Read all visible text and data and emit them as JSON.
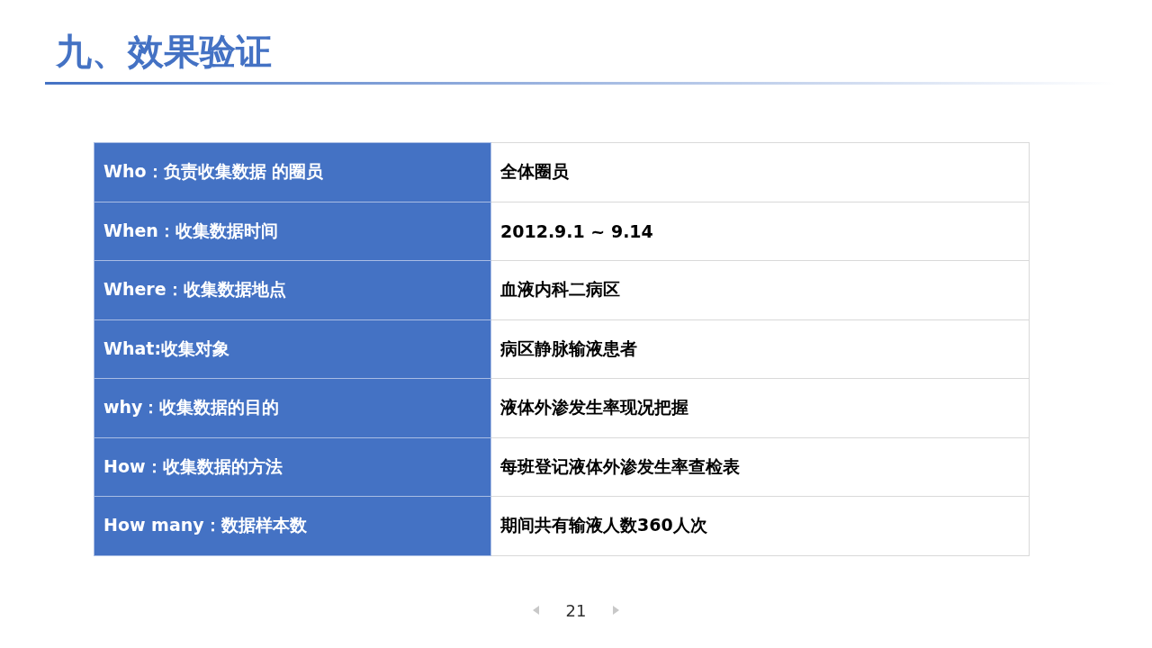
{
  "slide": {
    "title": "九、效果验证"
  },
  "table": {
    "rows": [
      {
        "label": "Who：负责收集数据 的圈员",
        "value": "全体圈员"
      },
      {
        "label": "When：收集数据时间",
        "value": "2012.9.1 ~ 9.14"
      },
      {
        "label": "Where：收集数据地点",
        "value": "血液内科二病区"
      },
      {
        "label": "What:收集对象",
        "value": "病区静脉输液患者"
      },
      {
        "label": "why：收集数据的目的",
        "value": "液体外渗发生率现况把握"
      },
      {
        "label": "How：收集数据的方法",
        "value": "每班登记液体外渗发生率查检表"
      },
      {
        "label": "How many：数据样本数",
        "value": "期间共有输液人数360人次"
      }
    ]
  },
  "pager": {
    "page": "21"
  }
}
